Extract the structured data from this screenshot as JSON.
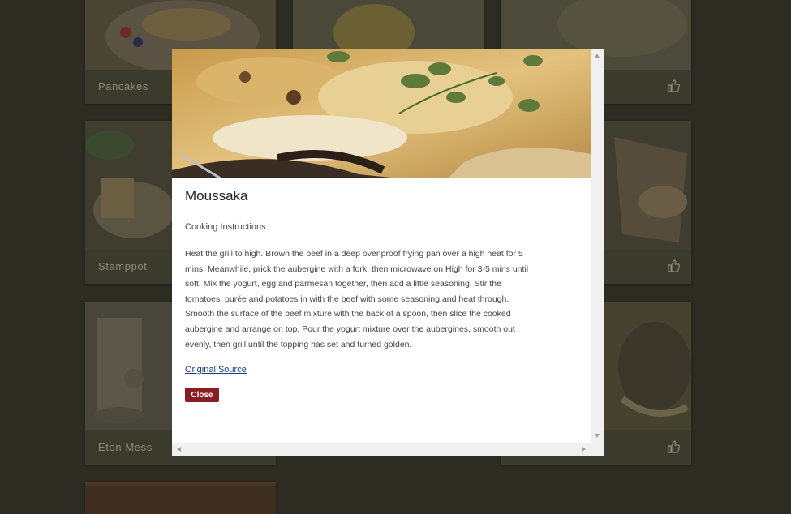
{
  "background_cards": [
    {
      "label": "Pancakes"
    },
    {
      "label": "Stamppot"
    },
    {
      "label": "Eton Mess"
    }
  ],
  "modal": {
    "title": "Moussaka",
    "subtitle": "Cooking Instructions",
    "instructions": "Heat the grill to high. Brown the beef in a deep ovenproof frying pan over a high heat for 5 mins. Meanwhile, prick the aubergine with a fork, then microwave on High for 3-5 mins until soft. Mix the yogurt, egg and parmesan together, then add a little seasoning. Stir the tomatoes, purée and potatoes in with the beef with some seasoning and heat through. Smooth the surface of the beef mixture with the back of a spoon, then slice the cooked aubergine and arrange on top. Pour the yogurt mixture over the aubergines, smooth out evenly, then grill until the topping has set and turned golden.",
    "source_link": "Original Source",
    "close_label": "Close"
  },
  "colors": {
    "accent": "#8a1d22",
    "link": "#1a3e8a",
    "backdrop": "#2c2c22"
  },
  "icons": {
    "like": "thumbs-up-icon"
  }
}
